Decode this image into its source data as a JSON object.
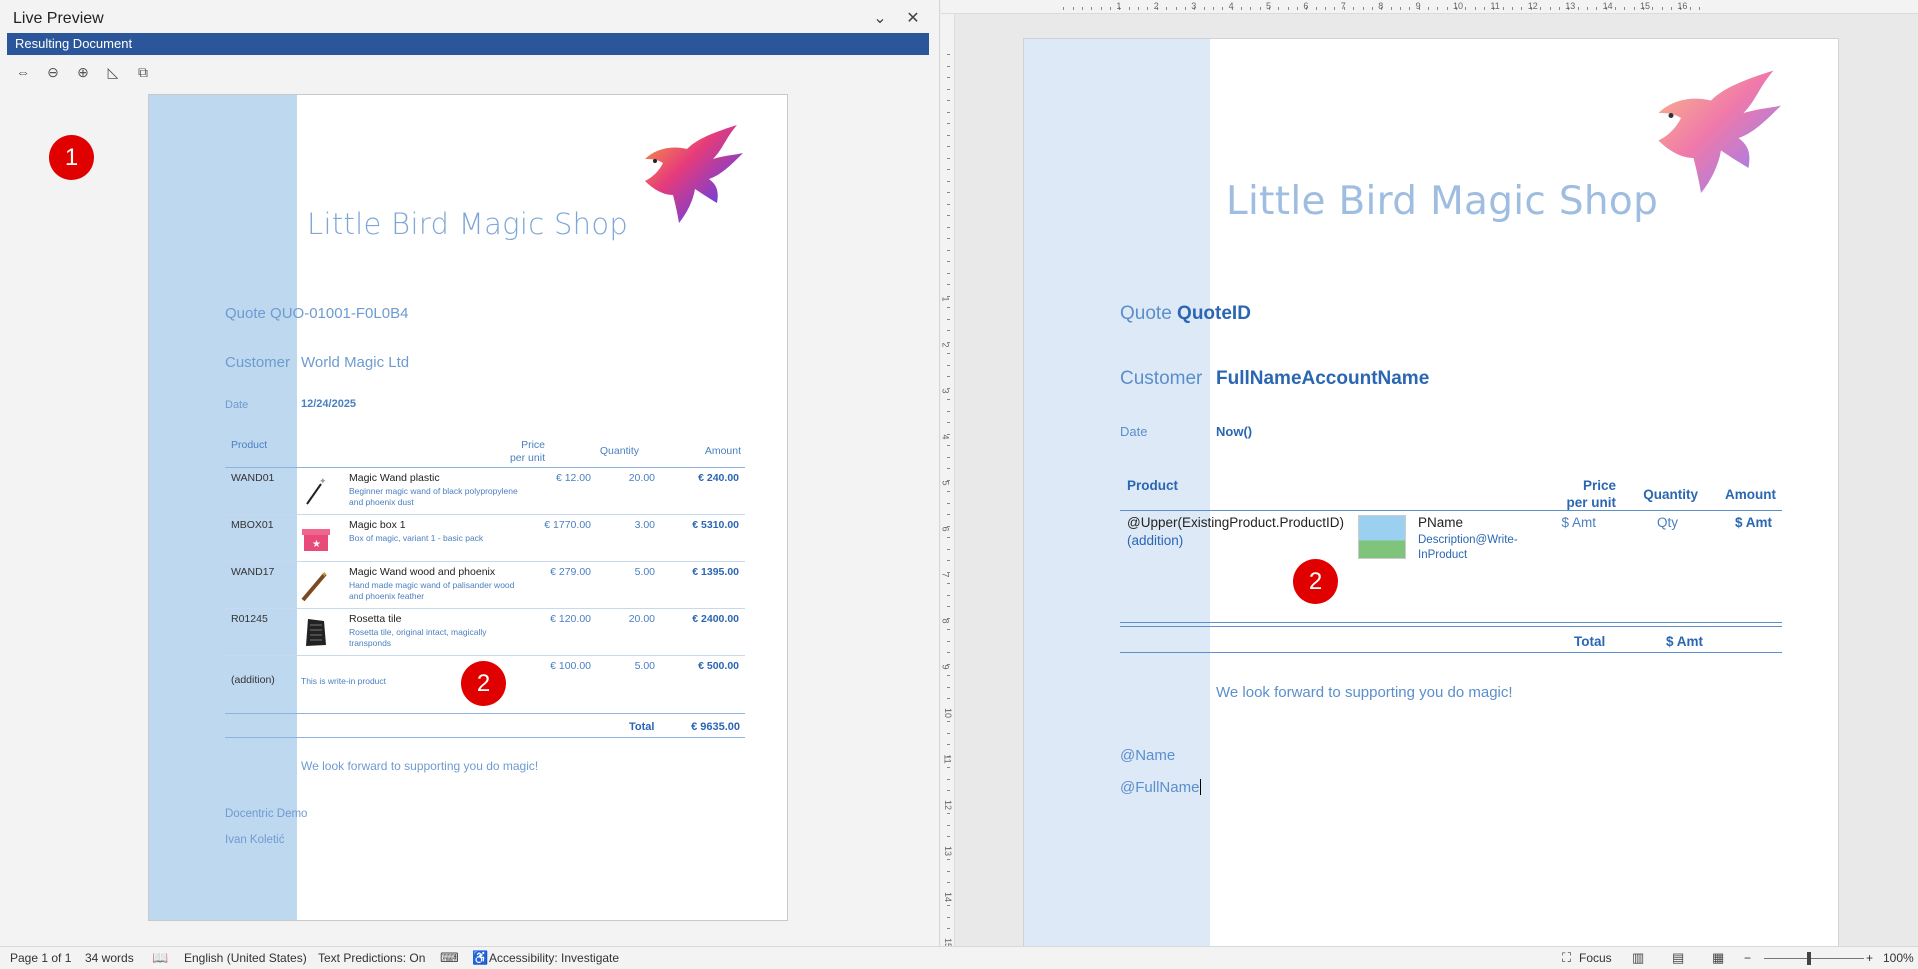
{
  "left_pane": {
    "title": "Live Preview",
    "dropdown_icon": "chevron-down-icon",
    "close_icon": "close-icon",
    "bar_label": "Resulting Document",
    "tools": [
      "fit-width-icon",
      "zoom-out-icon",
      "zoom-in-icon",
      "ruler-icon",
      "popout-icon"
    ],
    "badge_label": "1",
    "preview": {
      "shop_title": "Little Bird Magic Shop",
      "quote": "Quote QUO-01001-F0L0B4",
      "customer_label": "Customer",
      "customer_value": "World Magic Ltd",
      "date_label": "Date",
      "date_value": "12/24/2025",
      "headers": {
        "product": "Product",
        "price_l1": "Price",
        "price_l2": "per unit",
        "quantity": "Quantity",
        "amount": "Amount"
      },
      "rows": [
        {
          "id": "WAND01",
          "name": "Magic Wand plastic",
          "desc": "Beginner magic wand of black polypropylene and phoenix dust",
          "price": "€ 12.00",
          "qty": "20.00",
          "amount": "€ 240.00"
        },
        {
          "id": "MBOX01",
          "name": "Magic box 1",
          "desc": "Box of magic, variant 1 - basic pack",
          "price": "€ 1770.00",
          "qty": "3.00",
          "amount": "€ 5310.00"
        },
        {
          "id": "WAND17",
          "name": "Magic Wand wood and phoenix",
          "desc": "Hand made magic wand of palisander wood and phoenix feather",
          "price": "€ 279.00",
          "qty": "5.00",
          "amount": "€ 1395.00"
        },
        {
          "id": "R01245",
          "name": "Rosetta tile",
          "desc": "Rosetta tile, original intact, magically transponds",
          "price": "€ 120.00",
          "qty": "20.00",
          "amount": "€ 2400.00"
        },
        {
          "id": "(addition)",
          "name": "",
          "desc": "This is write-in product",
          "price": "€ 100.00",
          "qty": "5.00",
          "amount": "€ 500.00"
        }
      ],
      "badge_label": "2",
      "total_label": "Total",
      "total_value": "€ 9635.00",
      "footer": "We look forward to supporting you do magic!",
      "sig_company": "Docentric Demo",
      "sig_name": "Ivan Koletić"
    }
  },
  "editor": {
    "ruler_numbers": [
      "1",
      "2",
      "3",
      "4",
      "5",
      "6",
      "7",
      "8",
      "9",
      "10",
      "11",
      "12",
      "13",
      "14",
      "15",
      "16"
    ],
    "shop_title": "Little Bird Magic Shop",
    "quote_label": "Quote ",
    "quote_field": "QuoteID",
    "customer_label": "Customer",
    "customer_field": "FullNameAccountName",
    "date_label": "Date",
    "date_field": "Now()",
    "headers": {
      "product": "Product",
      "price_l1": "Price",
      "price_l2": "per unit",
      "quantity": "Quantity",
      "amount": "Amount"
    },
    "row": {
      "id": "@Upper(ExistingProduct.ProductID)",
      "addition": "(addition)",
      "name": "PName",
      "desc": "Description@Write-InProduct",
      "price": "$ Amt",
      "qty": "Qty",
      "amount": "$ Amt"
    },
    "badge_label": "2",
    "total_label": "Total",
    "total_value": "$ Amt",
    "footer": "We look forward to supporting you do magic!",
    "field_name": "@Name",
    "field_fullname": "@FullName"
  },
  "status_bar": {
    "page": "Page 1 of 1",
    "words": "34 words",
    "language": "English (United States)",
    "predictions": "Text Predictions: On",
    "accessibility": "Accessibility: Investigate",
    "focus": "Focus",
    "zoom": "100%",
    "zoom_level": 1.0
  },
  "colors": {
    "title_bar": "#2b579a",
    "accent_blue": "#2b66b2",
    "badge_red": "#e00000",
    "band_blue": "#bed8f0"
  }
}
